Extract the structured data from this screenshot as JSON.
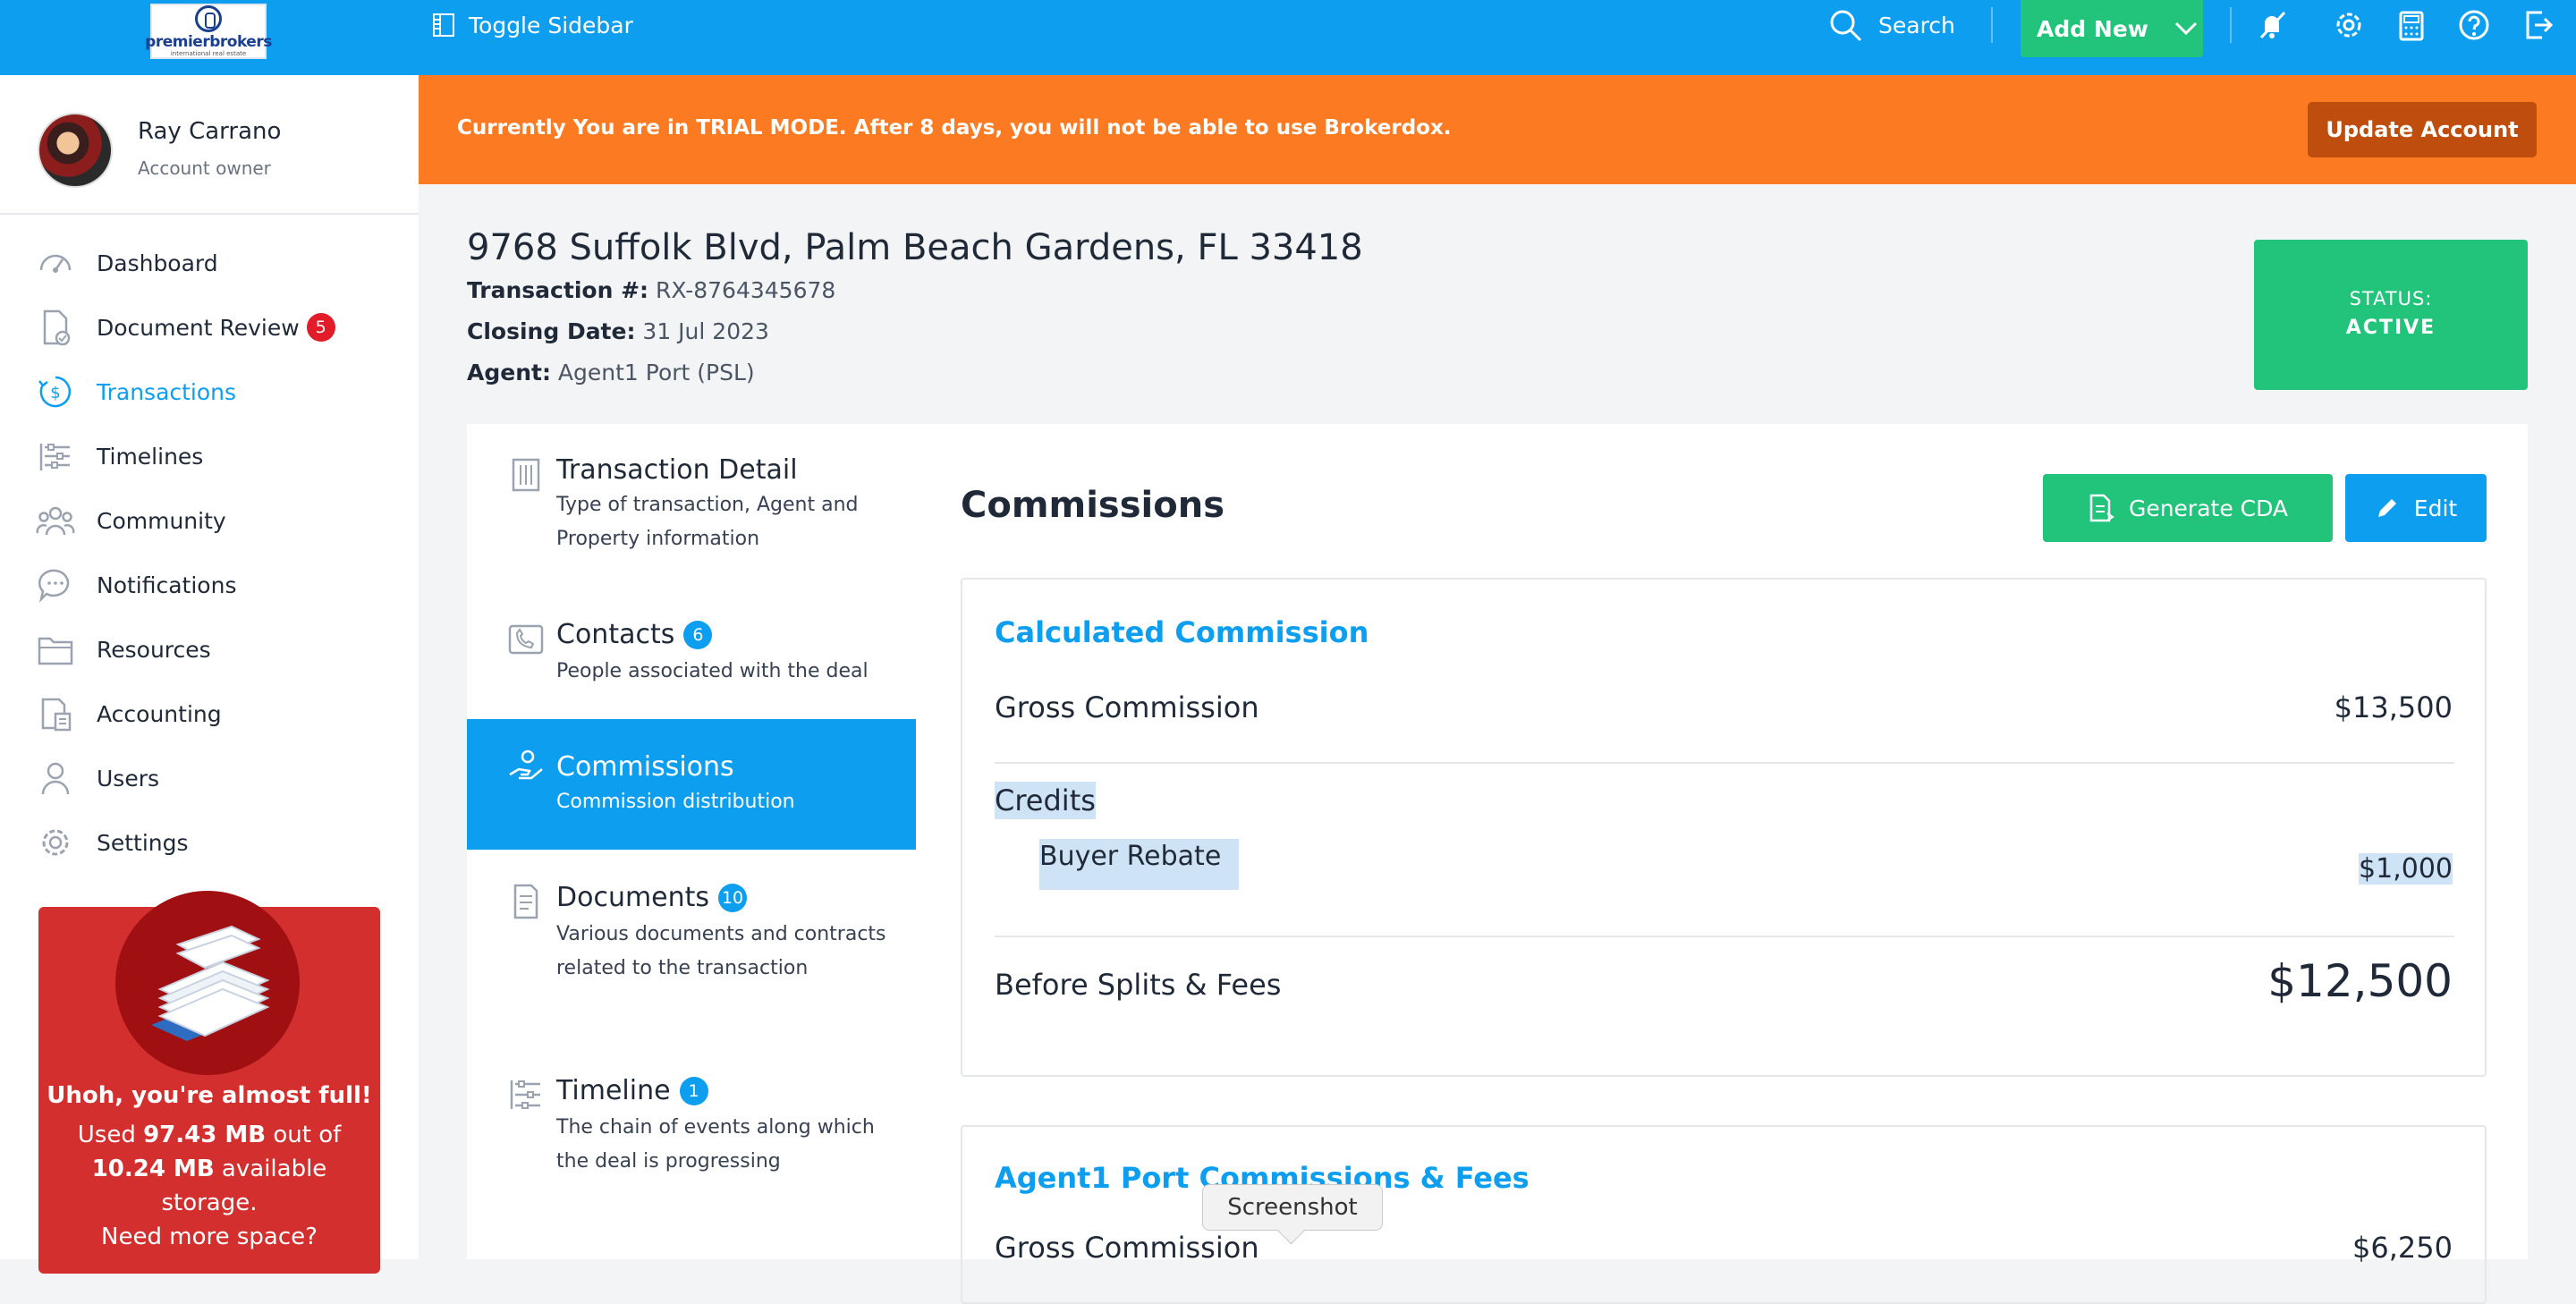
{
  "topbar": {
    "logo": {
      "name": "premierbrokers",
      "tagline": "international real estate"
    },
    "toggle_sidebar": "Toggle Sidebar",
    "search": "Search",
    "add_new": "Add New"
  },
  "sidebar": {
    "profile": {
      "name": "Ray Carrano",
      "role": "Account owner"
    },
    "items": [
      {
        "label": "Dashboard",
        "icon": "gauge-icon"
      },
      {
        "label": "Document Review",
        "icon": "document-check-icon",
        "badge": "5"
      },
      {
        "label": "Transactions",
        "icon": "dollar-cycle-icon",
        "active": true
      },
      {
        "label": "Timelines",
        "icon": "timeline-icon"
      },
      {
        "label": "Community",
        "icon": "community-icon"
      },
      {
        "label": "Notifications",
        "icon": "chat-bubble-icon"
      },
      {
        "label": "Resources",
        "icon": "folder-icon"
      },
      {
        "label": "Accounting",
        "icon": "accounting-icon"
      },
      {
        "label": "Users",
        "icon": "user-icon"
      },
      {
        "label": "Settings",
        "icon": "gear-icon"
      }
    ],
    "storage": {
      "title": "Uhoh, you're almost full!",
      "used_prefix": "Used ",
      "used": "97.43 MB",
      "out_of": " out of ",
      "total": "10.24 MB",
      "suffix": " available storage.",
      "cta": "Need more space?"
    }
  },
  "banner": {
    "text": "Currently You are in TRIAL MODE. After 8 days, you will not be able to use Brokerdox.",
    "button": "Update Account"
  },
  "transaction": {
    "address": "9768 Suffolk Blvd, Palm Beach Gardens, FL 33418",
    "number_label": "Transaction #:",
    "number": "RX-8764345678",
    "closing_label": "Closing Date:",
    "closing": "31 Jul 2023",
    "agent_label": "Agent:",
    "agent": "Agent1 Port (PSL)",
    "status_label": "STATUS:",
    "status": "ACTIVE"
  },
  "sections": [
    {
      "title": "Transaction Detail",
      "subtitle": "Type of transaction, Agent and Property information",
      "icon": "building-icon"
    },
    {
      "title": "Contacts",
      "badge": "6",
      "subtitle": "People associated with the deal",
      "icon": "phone-icon"
    },
    {
      "title": "Commissions",
      "subtitle": "Commission distribution",
      "icon": "hand-coin-icon",
      "active": true
    },
    {
      "title": "Documents",
      "badge": "10",
      "subtitle": "Various documents and contracts related to the transaction",
      "icon": "document-icon"
    },
    {
      "title": "Timeline",
      "badge": "1",
      "subtitle": "The chain of events along which the deal is progressing",
      "icon": "timeline-icon"
    }
  ],
  "commissions": {
    "title": "Commissions",
    "generate_cda": "Generate CDA",
    "edit": "Edit",
    "calculated": {
      "heading": "Calculated Commission",
      "gross_label": "Gross Commission",
      "gross_value": "$13,500",
      "credits_label": "Credits",
      "buyer_rebate_label": "Buyer Rebate",
      "buyer_rebate_value": "$1,000",
      "before_label": "Before Splits & Fees",
      "before_value": "$12,500"
    },
    "agent": {
      "heading": "Agent1 Port Commissions & Fees",
      "gross_label": "Gross Commission",
      "gross_value": "$6,250"
    }
  },
  "tooltip": "Screenshot"
}
